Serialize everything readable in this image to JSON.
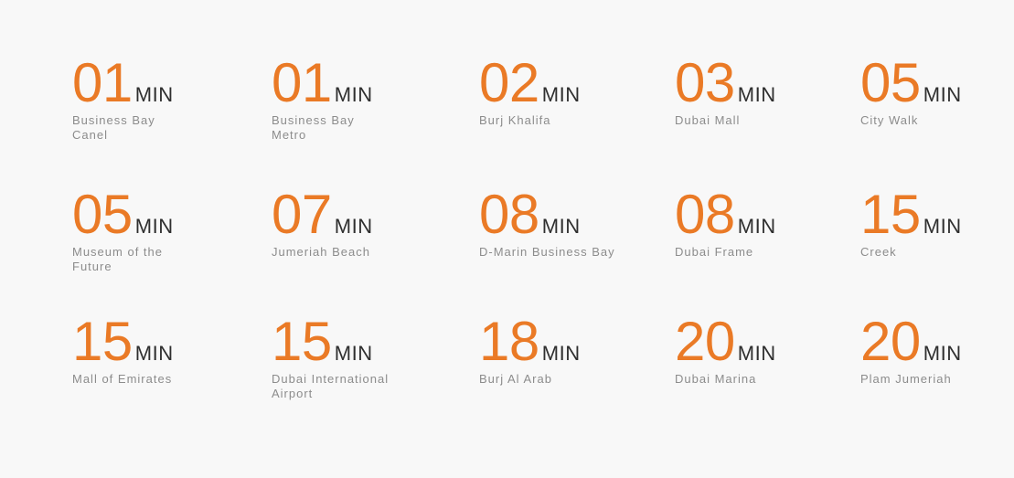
{
  "items": [
    {
      "value": "01",
      "unit": "MIN",
      "label": "Business Bay\nCanel"
    },
    {
      "value": "01",
      "unit": "MIN",
      "label": "Business Bay\nMetro"
    },
    {
      "value": "02",
      "unit": "MIN",
      "label": "Burj Khalifa"
    },
    {
      "value": "03",
      "unit": "MIN",
      "label": "Dubai Mall"
    },
    {
      "value": "05",
      "unit": "MIN",
      "label": "City Walk"
    },
    {
      "value": "05",
      "unit": "MIN",
      "label": "Museum of the\nFuture"
    },
    {
      "value": "07",
      "unit": "MIN",
      "label": "Jumeriah Beach"
    },
    {
      "value": "08",
      "unit": "MIN",
      "label": "D-Marin Business Bay"
    },
    {
      "value": "08",
      "unit": "MIN",
      "label": "Dubai Frame"
    },
    {
      "value": "15",
      "unit": "MIN",
      "label": "Creek"
    },
    {
      "value": "15",
      "unit": "MIN",
      "label": "Mall of Emirates"
    },
    {
      "value": "15",
      "unit": "MIN",
      "label": "Dubai International\nAirport"
    },
    {
      "value": "18",
      "unit": "MIN",
      "label": "Burj Al Arab"
    },
    {
      "value": "20",
      "unit": "MIN",
      "label": "Dubai Marina"
    },
    {
      "value": "20",
      "unit": "MIN",
      "label": "Plam Jumeriah"
    }
  ],
  "colors": {
    "accent": "#ea7a26",
    "unit_text": "#2f2f2f",
    "label_text": "#8c8c8c",
    "background": "#f8f8f8"
  }
}
